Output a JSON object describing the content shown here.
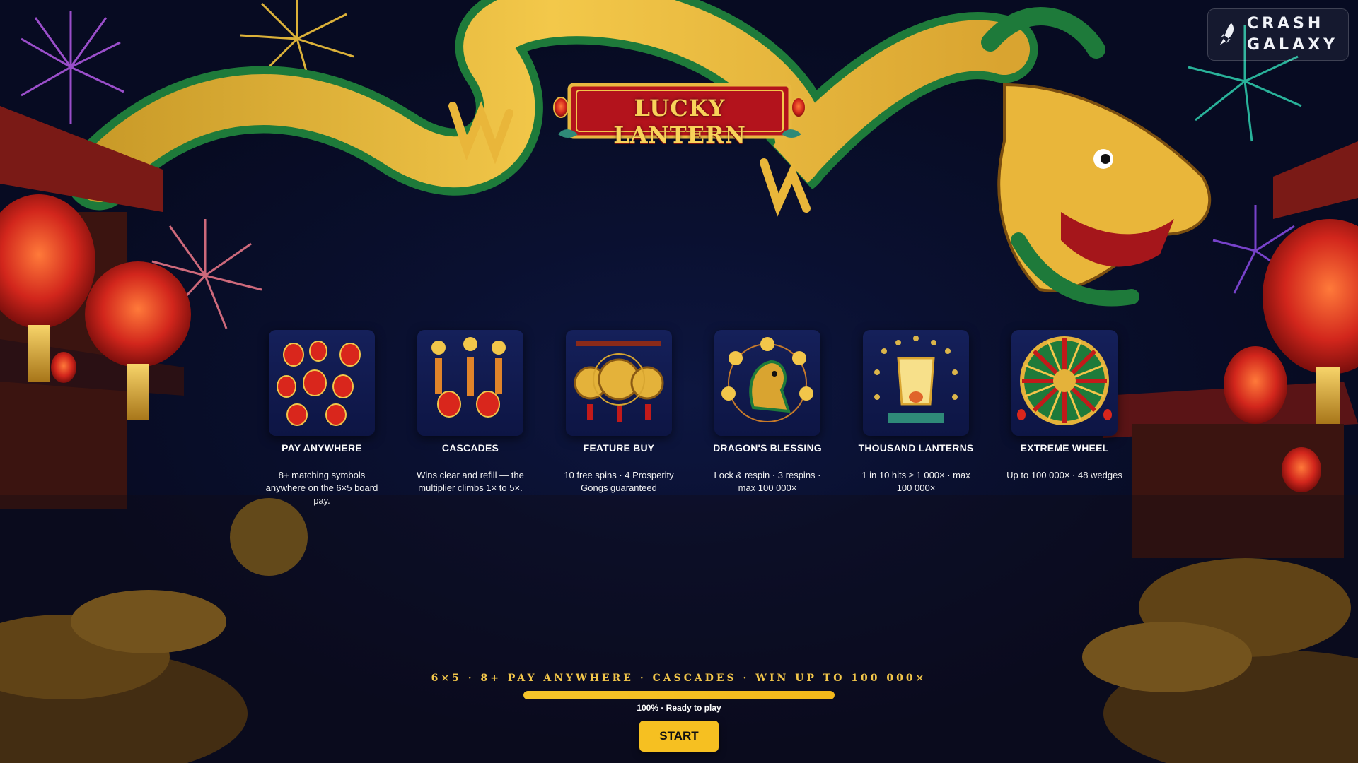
{
  "brand": {
    "logo_line1": "CRASH",
    "logo_line2": "GALAXY"
  },
  "game": {
    "title": "LUCKY LANTERN"
  },
  "features": [
    {
      "title": "PAY ANYWHERE",
      "description": "8+ matching symbols anywhere on the 6×5 board pay.",
      "icon": "lanterns-icon"
    },
    {
      "title": "CASCADES",
      "description": "Wins clear and refill — the multiplier climbs 1× to 5×.",
      "icon": "cascade-lanterns-icon"
    },
    {
      "title": "FEATURE BUY",
      "description": "10 free spins · 4 Prosperity Gongs guaranteed",
      "icon": "gongs-icon"
    },
    {
      "title": "DRAGON'S BLESSING",
      "description": "Lock & respin · 3 respins · max 100 000×",
      "icon": "dragon-icon"
    },
    {
      "title": "THOUSAND LANTERNS",
      "description": "1 in 10 hits ≥ 1 000× · max 100 000×",
      "icon": "sky-lantern-icon"
    },
    {
      "title": "EXTREME WHEEL",
      "description": "Up to 100 000× · 48 wedges",
      "icon": "wheel-icon"
    }
  ],
  "footer": {
    "tagline": "6×5 · 8+ PAY ANYWHERE · CASCADES · WIN UP TO 100 000×",
    "progress_label": "100% · Ready to play",
    "progress_percent": 100,
    "start_label": "START"
  },
  "colors": {
    "accent": "#f6c021",
    "background": "#0a1030",
    "banner_red": "#b3131c",
    "gold": "#f2c64a"
  }
}
